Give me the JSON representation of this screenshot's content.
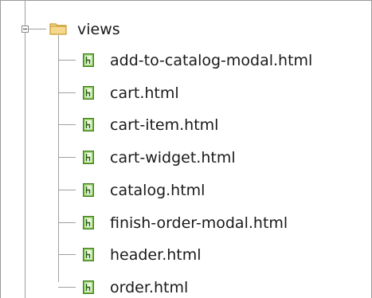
{
  "tree": {
    "folder": {
      "label": "views",
      "icon": "folder-icon",
      "expanded": true
    },
    "files": [
      {
        "label": "add-to-catalog-modal.html",
        "icon": "html-file-icon"
      },
      {
        "label": "cart.html",
        "icon": "html-file-icon"
      },
      {
        "label": "cart-item.html",
        "icon": "html-file-icon"
      },
      {
        "label": "cart-widget.html",
        "icon": "html-file-icon"
      },
      {
        "label": "catalog.html",
        "icon": "html-file-icon"
      },
      {
        "label": "finish-order-modal.html",
        "icon": "html-file-icon"
      },
      {
        "label": "header.html",
        "icon": "html-file-icon"
      },
      {
        "label": "order.html",
        "icon": "html-file-icon"
      }
    ],
    "colors": {
      "folder_fill": "#f5d78e",
      "folder_stroke": "#c89a2a",
      "file_fill": "#7fbf4d",
      "file_stroke": "#3d7a1e"
    }
  }
}
